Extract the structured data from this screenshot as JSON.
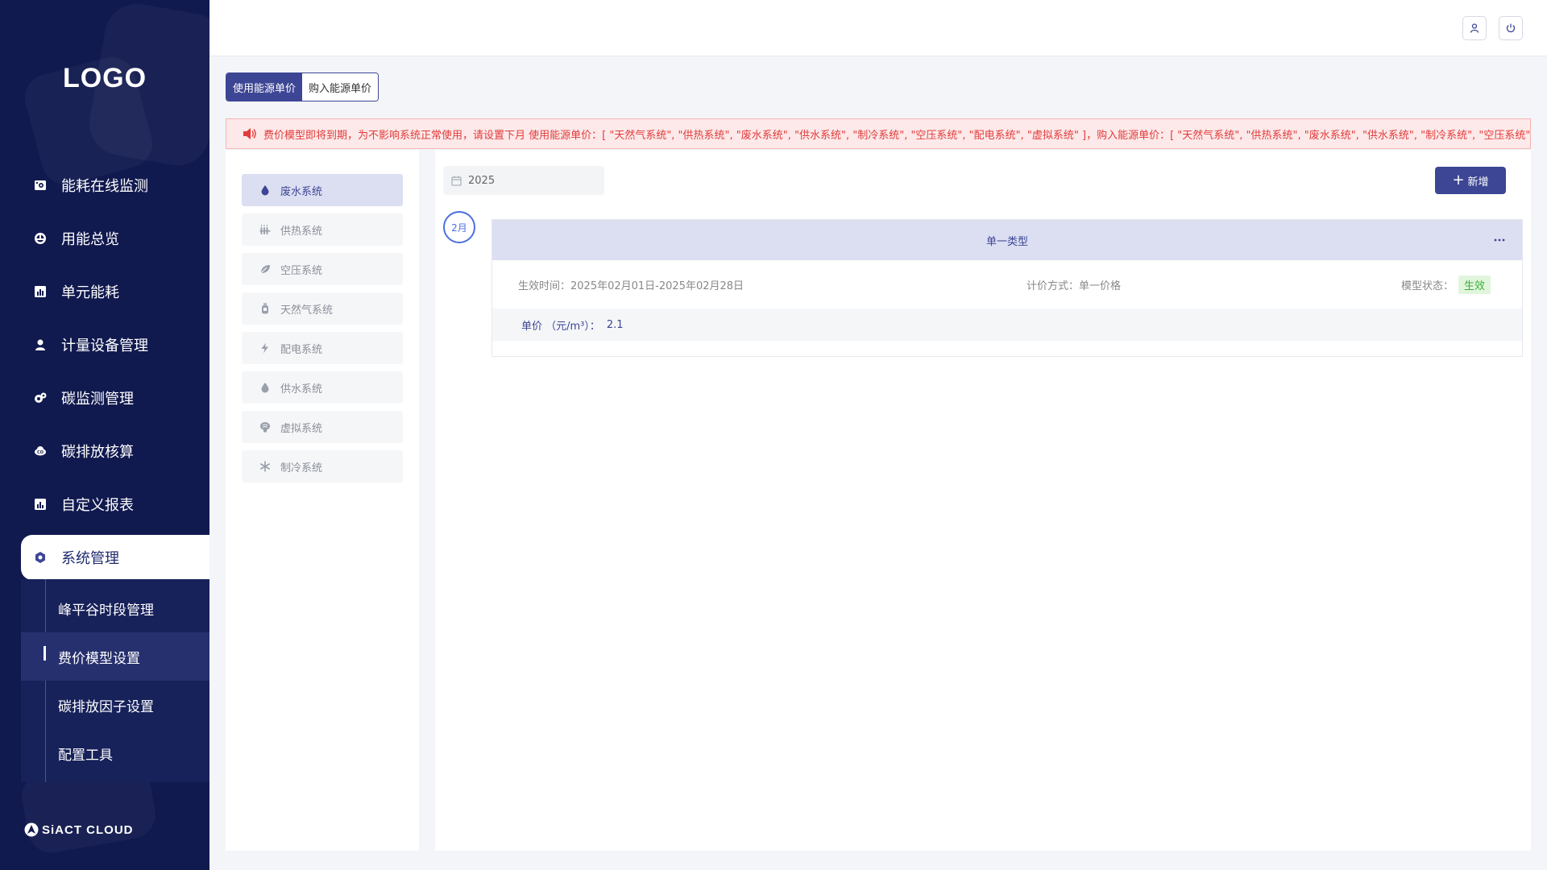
{
  "sidebar": {
    "logo": "LOGO",
    "menu": [
      {
        "label": "能耗在线监测",
        "icon": "monitor-icon"
      },
      {
        "label": "用能总览",
        "icon": "dashboard-icon"
      },
      {
        "label": "单元能耗",
        "icon": "bar-chart-icon"
      },
      {
        "label": "计量设备管理",
        "icon": "user-icon"
      },
      {
        "label": "碳监测管理",
        "icon": "gears-icon"
      },
      {
        "label": "碳排放核算",
        "icon": "cloud-icon"
      },
      {
        "label": "自定义报表",
        "icon": "report-icon"
      },
      {
        "label": "系统管理",
        "icon": "settings-icon"
      }
    ],
    "submenu": [
      {
        "label": "峰平谷时段管理"
      },
      {
        "label": "费价模型设置"
      },
      {
        "label": "碳排放因子设置"
      },
      {
        "label": "配置工具"
      }
    ],
    "brand": "SiACT CLOUD"
  },
  "header": {
    "user_icon": "user-icon",
    "power_icon": "power-icon"
  },
  "tabs": [
    {
      "label": "使用能源单价"
    },
    {
      "label": "购入能源单价"
    }
  ],
  "notice": {
    "text": "费价模型即将到期，为不影响系统正常使用，请设置下月 使用能源单价：[ \"天然气系统\", \"供热系统\", \"废水系统\", \"供水系统\", \"制冷系统\", \"空压系统\", \"配电系统\", \"虚拟系统\" ]，购入能源单价：[ \"天然气系统\", \"供热系统\", \"废水系统\", \"供水系统\", \"制冷系统\", \"空压系统\","
  },
  "systems": [
    {
      "label": "废水系统",
      "icon": "water-drop-icon"
    },
    {
      "label": "供热系统",
      "icon": "heating-icon"
    },
    {
      "label": "空压系统",
      "icon": "leaf-icon"
    },
    {
      "label": "天然气系统",
      "icon": "gas-tank-icon"
    },
    {
      "label": "配电系统",
      "icon": "lightning-icon"
    },
    {
      "label": "供水系统",
      "icon": "water-drop-icon"
    },
    {
      "label": "虚拟系统",
      "icon": "brain-icon"
    },
    {
      "label": "制冷系统",
      "icon": "snowflake-icon"
    }
  ],
  "main": {
    "year": "2025",
    "add_label": "新增",
    "month": "2月",
    "card": {
      "title": "单一类型",
      "effective_label": "生效时间：",
      "effective_value": "2025年02月01日-2025年02月28日",
      "method_label": "计价方式：",
      "method_value": "单一价格",
      "status_label": "模型状态：",
      "status_value": "生效",
      "price_label": "单价 （元/m³）：",
      "price_value": "2.1"
    }
  },
  "colors": {
    "sidebar_bg": "#111a4f",
    "accent": "#3d4694",
    "notice_text": "#e23b3b",
    "status_green": "#3bb03b"
  }
}
